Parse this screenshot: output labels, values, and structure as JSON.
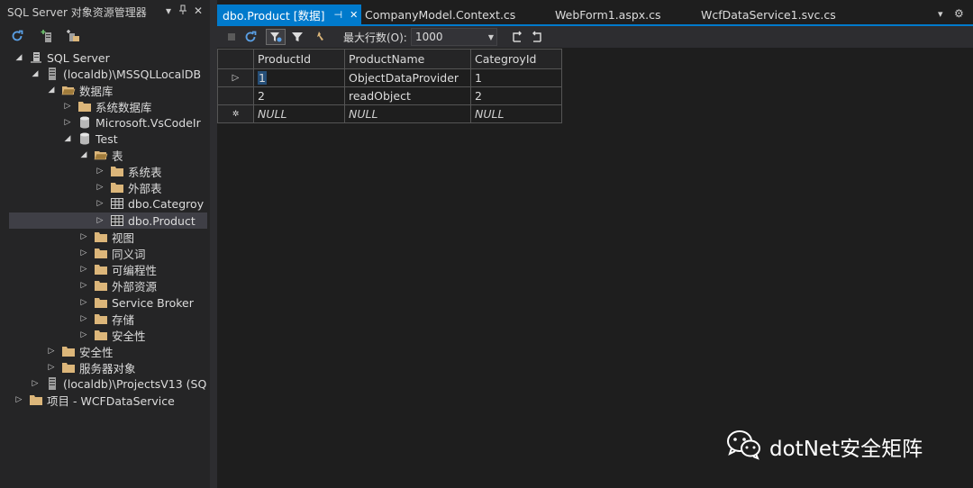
{
  "explorer": {
    "title": "SQL Server 对象资源管理器",
    "tree": [
      {
        "label": "SQL Server",
        "icon": "server-group-icon"
      },
      {
        "label": "(localdb)\\MSSQLLocalDB",
        "icon": "server-icon"
      },
      {
        "label": "数据库",
        "icon": "folder-icon"
      },
      {
        "label": "系统数据库",
        "icon": "folder-icon"
      },
      {
        "label": "Microsoft.VsCodeIr",
        "icon": "database-icon"
      },
      {
        "label": "Test",
        "icon": "database-icon"
      },
      {
        "label": "表",
        "icon": "folder-icon"
      },
      {
        "label": "系统表",
        "icon": "folder-icon"
      },
      {
        "label": "外部表",
        "icon": "folder-icon"
      },
      {
        "label": "dbo.Categroy",
        "icon": "table-icon"
      },
      {
        "label": "dbo.Product",
        "icon": "table-icon"
      },
      {
        "label": "视图",
        "icon": "folder-icon"
      },
      {
        "label": "同义词",
        "icon": "folder-icon"
      },
      {
        "label": "可编程性",
        "icon": "folder-icon"
      },
      {
        "label": "外部资源",
        "icon": "folder-icon"
      },
      {
        "label": "Service Broker",
        "icon": "folder-icon"
      },
      {
        "label": "存储",
        "icon": "folder-icon"
      },
      {
        "label": "安全性",
        "icon": "folder-icon"
      },
      {
        "label": "安全性",
        "icon": "folder-icon"
      },
      {
        "label": "服务器对象",
        "icon": "folder-icon"
      },
      {
        "label": "(localdb)\\ProjectsV13 (SQ",
        "icon": "server-icon"
      },
      {
        "label": "项目 - WCFDataService",
        "icon": "folder-icon"
      }
    ]
  },
  "tabs": [
    {
      "label": "dbo.Product [数据]",
      "active": true
    },
    {
      "label": "CompanyModel.Context.cs",
      "active": false
    },
    {
      "label": "WebForm1.aspx.cs",
      "active": false
    },
    {
      "label": "WcfDataService1.svc.cs",
      "active": false
    }
  ],
  "grid_toolbar": {
    "max_rows_label": "最大行数(O):",
    "max_rows_value": "1000"
  },
  "grid": {
    "columns": [
      "ProductId",
      "ProductName",
      "CategroyId"
    ],
    "rows": [
      [
        "1",
        "ObjectDataProvider",
        "1"
      ],
      [
        "2",
        "readObject",
        "2"
      ],
      [
        "NULL",
        "NULL",
        "NULL"
      ]
    ]
  },
  "watermark": {
    "text": "dotNet安全矩阵"
  },
  "colors": {
    "accent": "#007acc",
    "background": "#1e1e1e",
    "panel": "#252526",
    "folder": "#dcb67a"
  }
}
